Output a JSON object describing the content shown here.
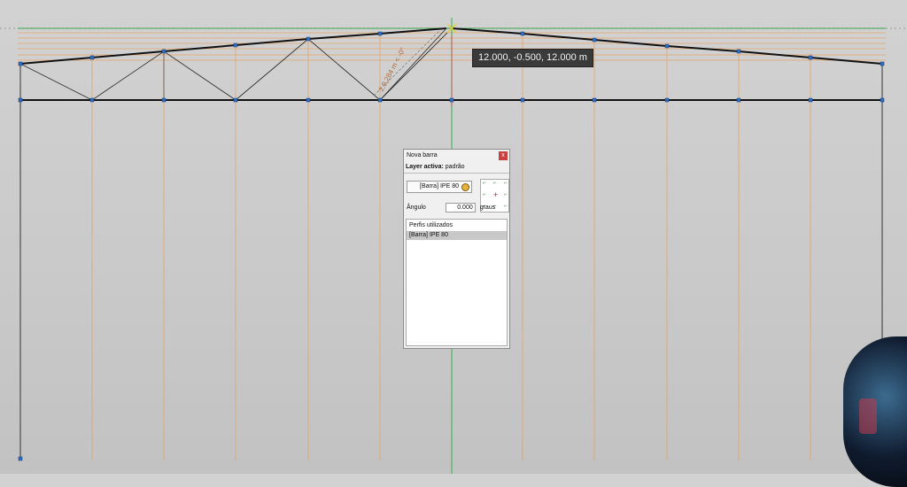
{
  "viewport": {
    "coordinate_tooltip": "12.000, -0.500, 12.000 m",
    "dimension_label": "2.9,284 m < -0°"
  },
  "dialog": {
    "title": "Nova barra",
    "close_label": "x",
    "layer_label": "Layer activa:",
    "layer_value": "padrão",
    "profile_button": "[Barra] IPE 80",
    "angle_label": "Ângulo",
    "angle_value": "0.000",
    "angle_unit": "graus",
    "profiles_header": "Perfis utilizados",
    "profiles_items": [
      "[Barra] IPE 80"
    ]
  },
  "colors": {
    "accent_orange": "#e19a55",
    "axis_green": "#2fb24a",
    "node_blue": "#2d6fc6",
    "member_black": "#111111"
  }
}
